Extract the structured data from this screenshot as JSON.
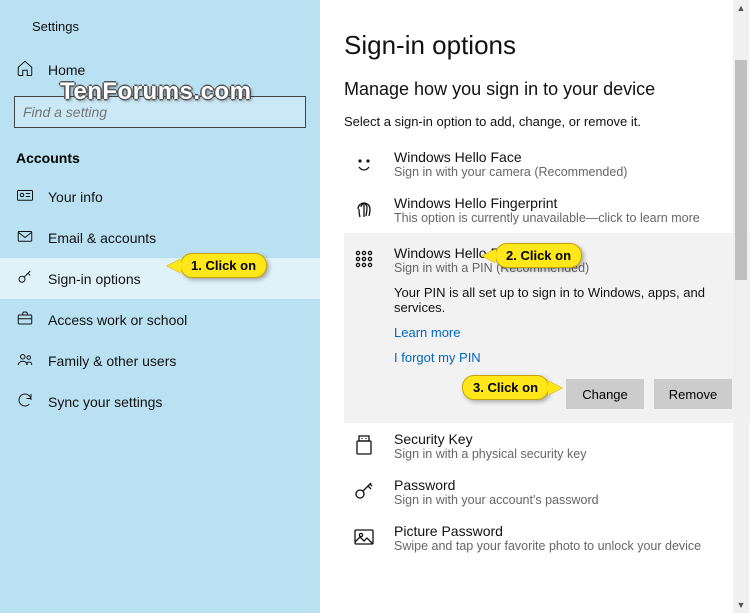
{
  "window": {
    "title": "Settings"
  },
  "watermark": "TenForums.com",
  "sidebar": {
    "home_label": "Home",
    "search_placeholder": "Find a setting",
    "section": "Accounts",
    "items": [
      {
        "label": "Your info"
      },
      {
        "label": "Email & accounts"
      },
      {
        "label": "Sign-in options"
      },
      {
        "label": "Access work or school"
      },
      {
        "label": "Family & other users"
      },
      {
        "label": "Sync your settings"
      }
    ]
  },
  "main": {
    "title": "Sign-in options",
    "subhead": "Manage how you sign in to your device",
    "caption": "Select a sign-in option to add, change, or remove it.",
    "options": {
      "face": {
        "name": "Windows Hello Face",
        "sub": "Sign in with your camera (Recommended)"
      },
      "fingerprint": {
        "name": "Windows Hello Fingerprint",
        "sub": "This option is currently unavailable—click to learn more"
      },
      "pin": {
        "name": "Windows Hello PIN",
        "sub": "Sign in with a PIN (Recommended)",
        "body": "Your PIN is all set up to sign in to Windows, apps, and services.",
        "learn": "Learn more",
        "forgot": "I forgot my PIN",
        "change": "Change",
        "remove": "Remove"
      },
      "seckey": {
        "name": "Security Key",
        "sub": "Sign in with a physical security key"
      },
      "password": {
        "name": "Password",
        "sub": "Sign in with your account's password"
      },
      "picpwd": {
        "name": "Picture Password",
        "sub": "Swipe and tap your favorite photo to unlock your device"
      }
    }
  },
  "annotations": {
    "c1": "1. Click on",
    "c2": "2. Click on",
    "c3": "3. Click on"
  }
}
